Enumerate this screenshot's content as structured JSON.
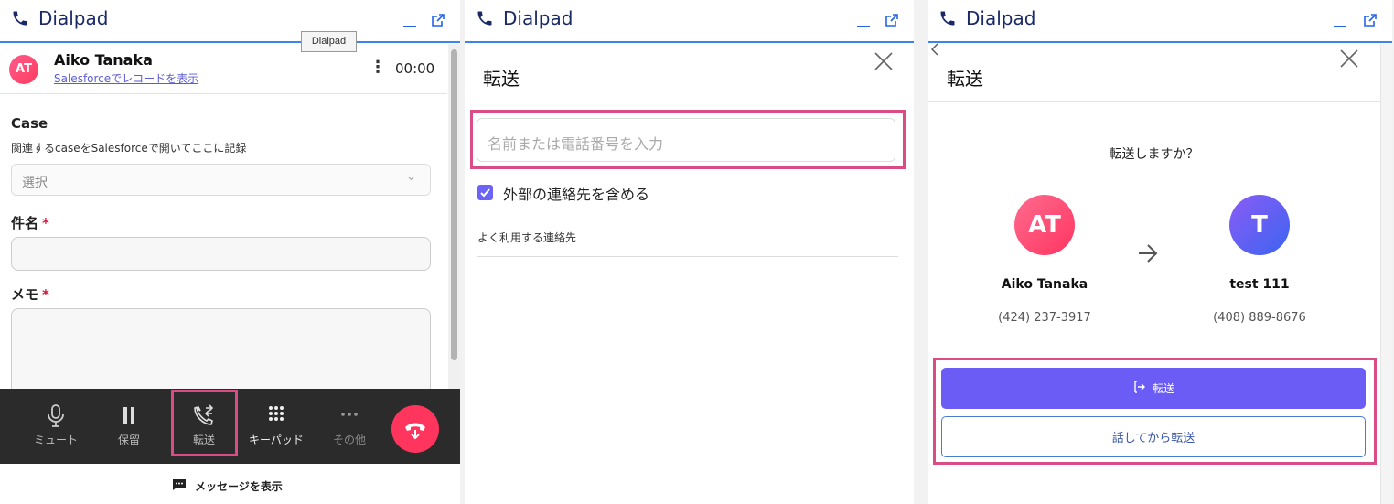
{
  "app_title": "Dialpad",
  "tooltip": "Dialpad",
  "panel1": {
    "caller_initials": "AT",
    "caller_name": "Aiko Tanaka",
    "salesforce_link": "Salesforceでレコードを表示",
    "more_menu": "⋮",
    "timer": "00:00",
    "case_label": "Case",
    "case_hint": "関連するcaseをSalesforceで開いてここに記録",
    "case_select_value": "選択",
    "subject_label": "件名",
    "memo_label": "メモ",
    "required_mark": "*",
    "toolbar": {
      "mute": "ミュート",
      "hold": "保留",
      "transfer": "転送",
      "keypad": "キーパッド",
      "more": "その他"
    },
    "show_messages": "メッセージを表示"
  },
  "panel2": {
    "title": "転送",
    "search_placeholder": "名前または電話番号を入力",
    "include_external": "外部の連絡先を含める",
    "include_external_checked": true,
    "frequent_contacts": "よく利用する連絡先"
  },
  "panel3": {
    "title": "転送",
    "question": "転送しますか？",
    "from": {
      "initials": "AT",
      "name": "Aiko Tanaka",
      "number": "(424) 237-3917"
    },
    "to": {
      "initials": "T",
      "name": "test 111",
      "number": "(408) 889-8676"
    },
    "transfer_button": "転送",
    "talk_then_transfer_button": "話してから転送"
  },
  "colors": {
    "accent_blue": "#3b82f6",
    "highlight_pink": "#d94c86",
    "primary_purple": "#6b5cf6",
    "hangup_red": "#ff355e",
    "toolbar_bg": "#2b2b2b"
  },
  "icons": [
    "phone-icon",
    "minimize-icon",
    "popout-icon",
    "close-icon",
    "chevron-down-icon",
    "microphone-icon",
    "pause-icon",
    "transfer-icon",
    "keypad-icon",
    "more-icon",
    "hangup-icon",
    "message-icon",
    "back-chevron-icon",
    "arrow-right-icon",
    "transfer-arrow-icon"
  ]
}
